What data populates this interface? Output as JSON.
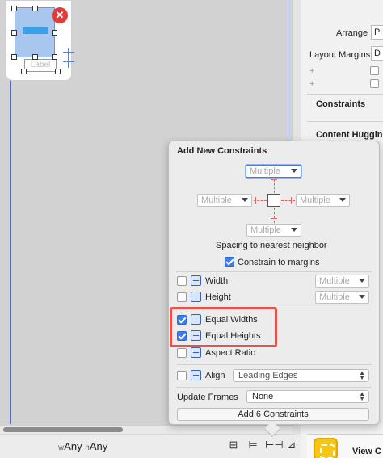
{
  "canvas": {
    "thumbnail_label": "Label"
  },
  "bottom_bar": {
    "width_prefix": "w",
    "width_value": "Any",
    "height_prefix": "h",
    "height_value": "Any"
  },
  "inspector": {
    "arrange_label": "Arrange",
    "arrange_value": "Pl",
    "layout_margins_label": "Layout Margins",
    "layout_margins_value": "D",
    "constraints_label": "Constraints",
    "content_hugging_label": "Content Hugging",
    "view_controller_label": "View C"
  },
  "popover": {
    "title": "Add New Constraints",
    "top_spacing": "Multiple",
    "left_spacing": "Multiple",
    "right_spacing": "Multiple",
    "bottom_spacing": "Multiple",
    "spacing_caption": "Spacing to nearest neighbor",
    "constrain_to_margins": "Constrain to margins",
    "width_label": "Width",
    "width_value": "Multiple",
    "height_label": "Height",
    "height_value": "Multiple",
    "equal_widths": "Equal Widths",
    "equal_heights": "Equal Heights",
    "aspect_ratio": "Aspect Ratio",
    "align_label": "Align",
    "align_value": "Leading Edges",
    "update_frames_label": "Update Frames",
    "update_frames_value": "None",
    "add_button": "Add 6 Constraints"
  },
  "colors": {
    "checkbox_on": "#3c7df5",
    "highlight": "#e8524a",
    "strut": "#d96a6a"
  }
}
